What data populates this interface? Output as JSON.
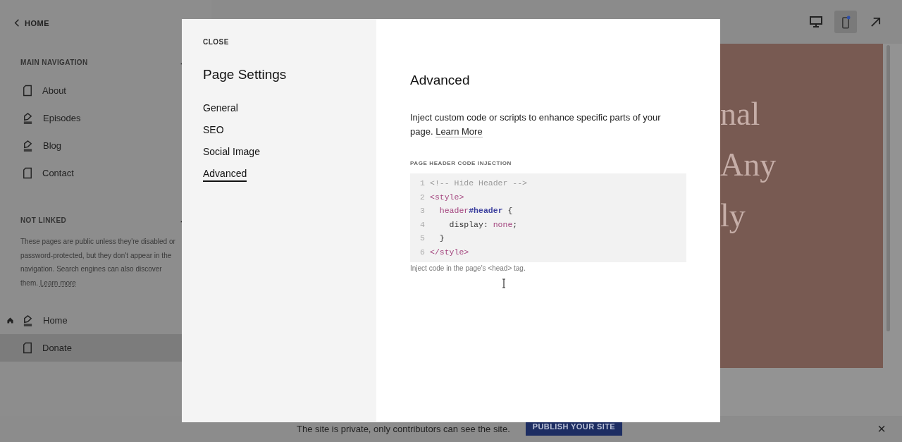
{
  "sidebar": {
    "back": "HOME",
    "sections": [
      {
        "title": "MAIN NAVIGATION",
        "collapse": "-",
        "items": [
          {
            "label": "About",
            "kind": "page",
            "homepage": false,
            "selected": false
          },
          {
            "label": "Episodes",
            "kind": "collection",
            "homepage": false,
            "selected": false
          },
          {
            "label": "Blog",
            "kind": "collection",
            "homepage": false,
            "selected": false
          },
          {
            "label": "Contact",
            "kind": "page",
            "homepage": false,
            "selected": false
          }
        ]
      },
      {
        "title": "NOT LINKED",
        "collapse": "-",
        "note": "These pages are public unless they're disabled or password-protected, but they don't appear in the navigation. Search engines can also discover them.",
        "note_link": "Learn more",
        "items": [
          {
            "label": "Home",
            "kind": "collection",
            "homepage": true,
            "selected": false
          },
          {
            "label": "Donate",
            "kind": "page",
            "homepage": false,
            "selected": true
          }
        ]
      }
    ]
  },
  "preview": {
    "devices": [
      {
        "kind": "desktop",
        "selected": false
      },
      {
        "kind": "mobile",
        "selected": true
      },
      {
        "kind": "open",
        "selected": false
      }
    ],
    "hero_lines": [
      "nal",
      "Any",
      "ly"
    ]
  },
  "banner": {
    "text": "The site is private, only contributors can see the site.",
    "button": "PUBLISH YOUR SITE",
    "close": "×"
  },
  "modal": {
    "close": "CLOSE",
    "title": "Page Settings",
    "nav": [
      {
        "label": "General",
        "selected": false
      },
      {
        "label": "SEO",
        "selected": false
      },
      {
        "label": "Social Image",
        "selected": false
      },
      {
        "label": "Advanced",
        "selected": true
      }
    ],
    "heading": "Advanced",
    "description": "Inject custom code or scripts to enhance specific parts of your page.",
    "learn_more": "Learn More",
    "field_label": "PAGE HEADER CODE INJECTION",
    "code_lines": [
      {
        "number": "1",
        "tokens": [
          {
            "text": "<!-- Hide Header -->",
            "kind": "comment"
          }
        ]
      },
      {
        "number": "2",
        "tokens": [
          {
            "text": "<style>",
            "kind": "tag"
          }
        ]
      },
      {
        "number": "3",
        "tokens": [
          {
            "text": "  header",
            "kind": "tag"
          },
          {
            "text": "#header",
            "kind": "id"
          },
          {
            "text": " {",
            "kind": "plain"
          }
        ]
      },
      {
        "number": "4",
        "tokens": [
          {
            "text": "    display: ",
            "kind": "plain"
          },
          {
            "text": "none",
            "kind": "value"
          },
          {
            "text": ";",
            "kind": "plain"
          }
        ]
      },
      {
        "number": "5",
        "tokens": [
          {
            "text": "  }",
            "kind": "plain"
          }
        ]
      },
      {
        "number": "6",
        "tokens": [
          {
            "text": "</style>",
            "kind": "tag"
          }
        ]
      }
    ],
    "hint": "Inject code in the page's <head> tag."
  }
}
